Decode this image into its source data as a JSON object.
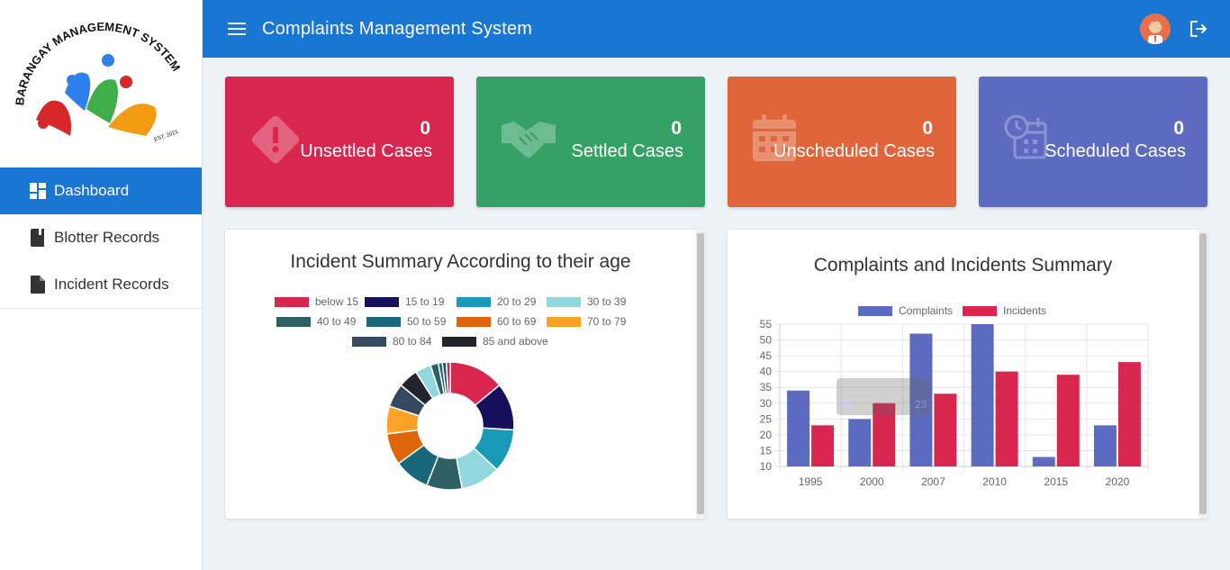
{
  "logo": {
    "alt": "Barangay Management System",
    "text": "BARANGAY MANAGEMENT SYSTEM",
    "est": "EST. 2021"
  },
  "sidebar": {
    "items": [
      {
        "label": "Dashboard",
        "icon": "dashboard-icon",
        "active": true
      },
      {
        "label": "Blotter Records",
        "icon": "book-icon",
        "active": false
      },
      {
        "label": "Incident Records",
        "icon": "file-icon",
        "active": false
      }
    ]
  },
  "header": {
    "title": "Complaints Management System",
    "menu_icon": "hamburger-icon",
    "logout_icon": "logout-icon"
  },
  "cards": [
    {
      "value": "0",
      "label": "Unsettled Cases",
      "color": "#d8264f",
      "icon": "warning-diamond-icon"
    },
    {
      "value": "0",
      "label": "Settled Cases",
      "color": "#35a165",
      "icon": "handshake-icon"
    },
    {
      "value": "0",
      "label": "Unscheduled Cases",
      "color": "#e0653b",
      "icon": "calendar-icon"
    },
    {
      "value": "0",
      "label": "Scheduled Cases",
      "color": "#5c6bc0",
      "icon": "calendar-clock-icon"
    }
  ],
  "age_panel": {
    "title": "Incident Summary According to their age"
  },
  "summary_panel": {
    "title": "Complaints and Incidents Summary"
  },
  "chart_data": [
    {
      "type": "pie",
      "variant": "doughnut",
      "title": "Incident Summary According to their age",
      "legend_position": "top",
      "categories": [
        "below 15",
        "15 to 19",
        "20 to 29",
        "30 to 39",
        "40 to 49",
        "50 to 59",
        "60 to 69",
        "70 to 79",
        "80 to 84",
        "85 and above"
      ],
      "colors": [
        "#d8264f",
        "#160f5c",
        "#1b99b9",
        "#93d7de",
        "#2d5f64",
        "#17687a",
        "#e0650a",
        "#fba126",
        "#34495e",
        "#22252b"
      ],
      "values": [
        14,
        12,
        11,
        10,
        9,
        9,
        8,
        7,
        6,
        5,
        4,
        2,
        1,
        1,
        1
      ],
      "slice_colors": [
        "#d8264f",
        "#160f5c",
        "#1b99b9",
        "#93d7de",
        "#2d5f64",
        "#17687a",
        "#e0650a",
        "#fba126",
        "#34495e",
        "#22252b",
        "#93d7de",
        "#2d5f64",
        "#17687a",
        "#34495e",
        "#d8264f"
      ]
    },
    {
      "type": "bar",
      "title": "Complaints and Incidents Summary",
      "legend_position": "top",
      "categories": [
        "1995",
        "2000",
        "2007",
        "2010",
        "2015",
        "2020"
      ],
      "series": [
        {
          "name": "Complaints",
          "color": "#5c6bc0",
          "values": [
            34,
            25,
            52,
            55,
            13,
            23
          ]
        },
        {
          "name": "Incidents",
          "color": "#d8264f",
          "values": [
            23,
            30,
            33,
            40,
            39,
            43
          ]
        }
      ],
      "ylim": [
        10,
        55
      ],
      "yticks": [
        10,
        15,
        20,
        25,
        30,
        35,
        40,
        45,
        50,
        55
      ],
      "grid": true,
      "tooltip": {
        "value": "23"
      }
    }
  ]
}
